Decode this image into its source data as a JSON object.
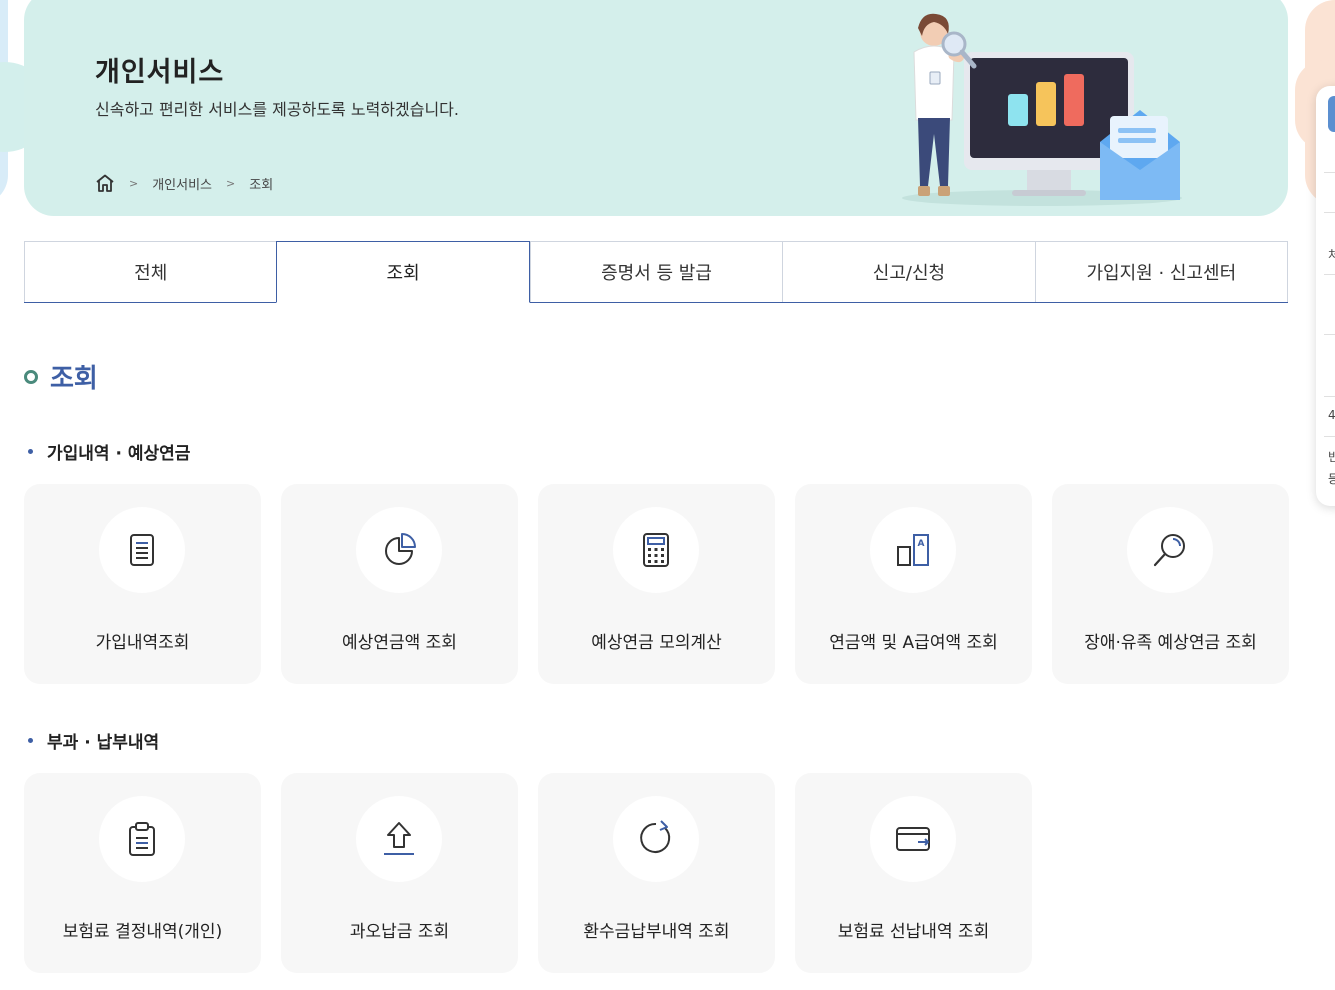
{
  "hero": {
    "title": "개인서비스",
    "subtitle": "신속하고 편리한 서비스를 제공하도록 노력하겠습니다.",
    "breadcrumb": [
      "개인서비스",
      "조회"
    ]
  },
  "tabs": [
    {
      "label": "전체",
      "active": false
    },
    {
      "label": "조회",
      "active": true
    },
    {
      "label": "증명서 등 발급",
      "active": false
    },
    {
      "label": "신고/신청",
      "active": false
    },
    {
      "label": "가입지원 · 신고센터",
      "active": false
    }
  ],
  "section": {
    "title": "조회",
    "groups": [
      {
        "title": "가입내역 · 예상연금",
        "cards": [
          {
            "label": "가입내역조회",
            "icon": "document-icon"
          },
          {
            "label": "예상연금액 조회",
            "icon": "pie-chart-icon"
          },
          {
            "label": "예상연금 모의계산",
            "icon": "calculator-icon"
          },
          {
            "label": "연금액 및 A급여액 조회",
            "icon": "compare-a-icon"
          },
          {
            "label": "장애·유족 예상연금 조회",
            "icon": "magnifier-icon"
          }
        ]
      },
      {
        "title": "부과 · 납부내역",
        "cards": [
          {
            "label": "보험료 결정내역(개인)",
            "icon": "clipboard-icon"
          },
          {
            "label": "과오납금 조회",
            "icon": "upload-arrow-icon"
          },
          {
            "label": "환수금납부내역 조회",
            "icon": "refresh-icon"
          },
          {
            "label": "보험료 선납내역 조회",
            "icon": "wallet-icon"
          }
        ]
      }
    ]
  },
  "side_panel_fragments": [
    "처",
    "4",
    "빈",
    "등"
  ],
  "colors": {
    "hero_bg": "#d4efeb",
    "accent": "#3e5fa5",
    "ring": "#4a8a7c",
    "card_bg": "#f7f7f7"
  }
}
